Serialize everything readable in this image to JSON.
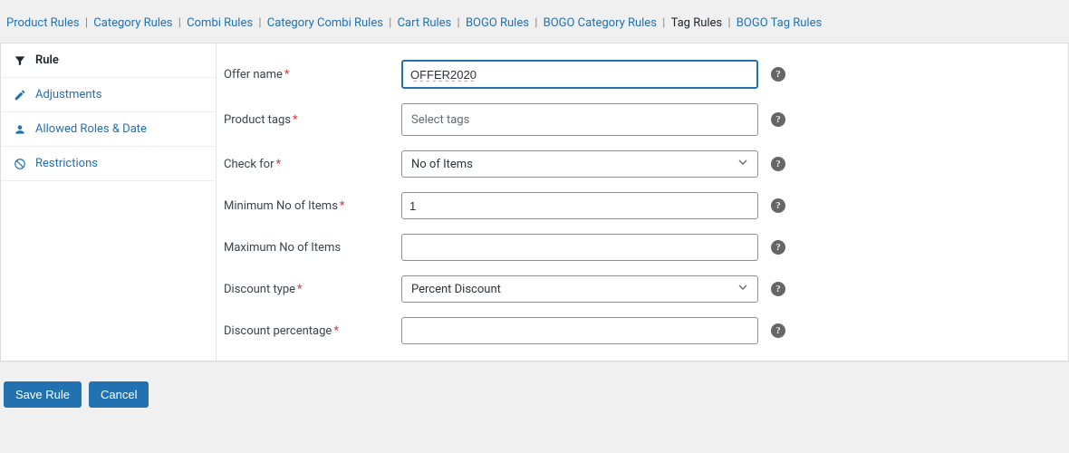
{
  "topnav": {
    "items": [
      {
        "label": "Product Rules",
        "active": false
      },
      {
        "label": "Category Rules",
        "active": false
      },
      {
        "label": "Combi Rules",
        "active": false
      },
      {
        "label": "Category Combi Rules",
        "active": false
      },
      {
        "label": "Cart Rules",
        "active": false
      },
      {
        "label": "BOGO Rules",
        "active": false
      },
      {
        "label": "BOGO Category Rules",
        "active": false
      },
      {
        "label": "Tag Rules",
        "active": true
      },
      {
        "label": "BOGO Tag Rules",
        "active": false
      }
    ]
  },
  "sidebar": {
    "items": [
      {
        "label": "Rule",
        "icon": "funnel",
        "active": true
      },
      {
        "label": "Adjustments",
        "icon": "pencil",
        "active": false
      },
      {
        "label": "Allowed Roles & Date",
        "icon": "user",
        "active": false
      },
      {
        "label": "Restrictions",
        "icon": "ban",
        "active": false
      }
    ]
  },
  "form": {
    "offer_name": {
      "label": "Offer name",
      "required": true,
      "value": "OFFER2020"
    },
    "product_tags": {
      "label": "Product tags",
      "required": true,
      "placeholder": "Select tags"
    },
    "check_for": {
      "label": "Check for",
      "required": true,
      "selected": "No of Items"
    },
    "min_items": {
      "label": "Minimum No of Items",
      "required": true,
      "value": "1"
    },
    "max_items": {
      "label": "Maximum No of Items",
      "required": false,
      "value": ""
    },
    "discount_type": {
      "label": "Discount type",
      "required": true,
      "selected": "Percent Discount"
    },
    "discount_percentage": {
      "label": "Discount percentage",
      "required": true,
      "value": ""
    }
  },
  "actions": {
    "save": "Save Rule",
    "cancel": "Cancel"
  }
}
